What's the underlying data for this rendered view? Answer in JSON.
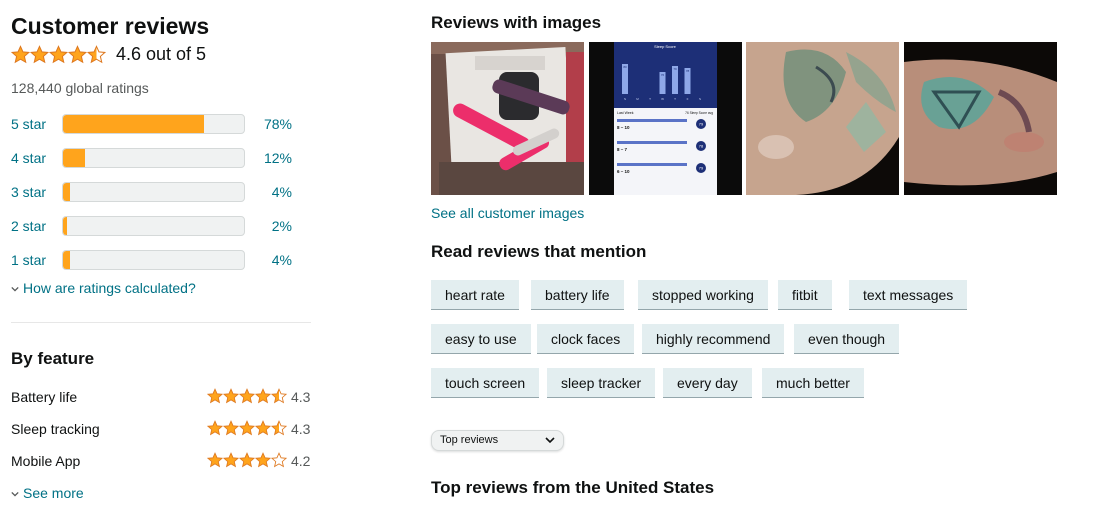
{
  "customer_reviews": {
    "title": "Customer reviews",
    "rating": 4.6,
    "rating_text": "4.6 out of 5",
    "global_ratings": "128,440 global ratings",
    "histogram": [
      {
        "label": "5 star",
        "percent_text": "78%",
        "percent": 78
      },
      {
        "label": "4 star",
        "percent_text": "12%",
        "percent": 12
      },
      {
        "label": "3 star",
        "percent_text": "4%",
        "percent": 4
      },
      {
        "label": "2 star",
        "percent_text": "2%",
        "percent": 2
      },
      {
        "label": "1 star",
        "percent_text": "4%",
        "percent": 4
      }
    ],
    "how_calculated": "How are ratings calculated?"
  },
  "by_feature": {
    "title": "By feature",
    "items": [
      {
        "name": "Battery life",
        "rating": 4.3,
        "rating_text": "4.3"
      },
      {
        "name": "Sleep tracking",
        "rating": 4.3,
        "rating_text": "4.3"
      },
      {
        "name": "Mobile App",
        "rating": 4.2,
        "rating_text": "4.2"
      }
    ],
    "see_more": "See more"
  },
  "images": {
    "title": "Reviews with images",
    "see_all": "See all customer images",
    "sleep_screen": {
      "header": "Sleep Score",
      "bar_values": [
        "80",
        "78",
        "79",
        "76",
        "79",
        "78",
        "76"
      ],
      "days": [
        "S",
        "M",
        "T",
        "W",
        "T",
        "F",
        "S"
      ],
      "last_week": "Last Week",
      "avg": "76 Sleep Score avg",
      "entries": [
        {
          "time": "8 – 10",
          "score": "79"
        },
        {
          "time": "8 – 7",
          "score": "78"
        },
        {
          "time": "6 – 10",
          "score": "79"
        }
      ]
    }
  },
  "mentions": {
    "title": "Read reviews that mention",
    "chips": [
      [
        "heart rate",
        "battery life",
        "stopped working",
        "fitbit",
        "text messages"
      ],
      [
        "easy to use",
        "clock faces",
        "highly recommend",
        "even though"
      ],
      [
        "touch screen",
        "sleep tracker",
        "every day",
        "much better"
      ]
    ]
  },
  "sort": {
    "selected": "Top reviews"
  },
  "top_reviews_title": "Top reviews from the United States",
  "colors": {
    "star": "#ffa41c",
    "link": "#007185",
    "chip_bg": "#e3eef0"
  }
}
